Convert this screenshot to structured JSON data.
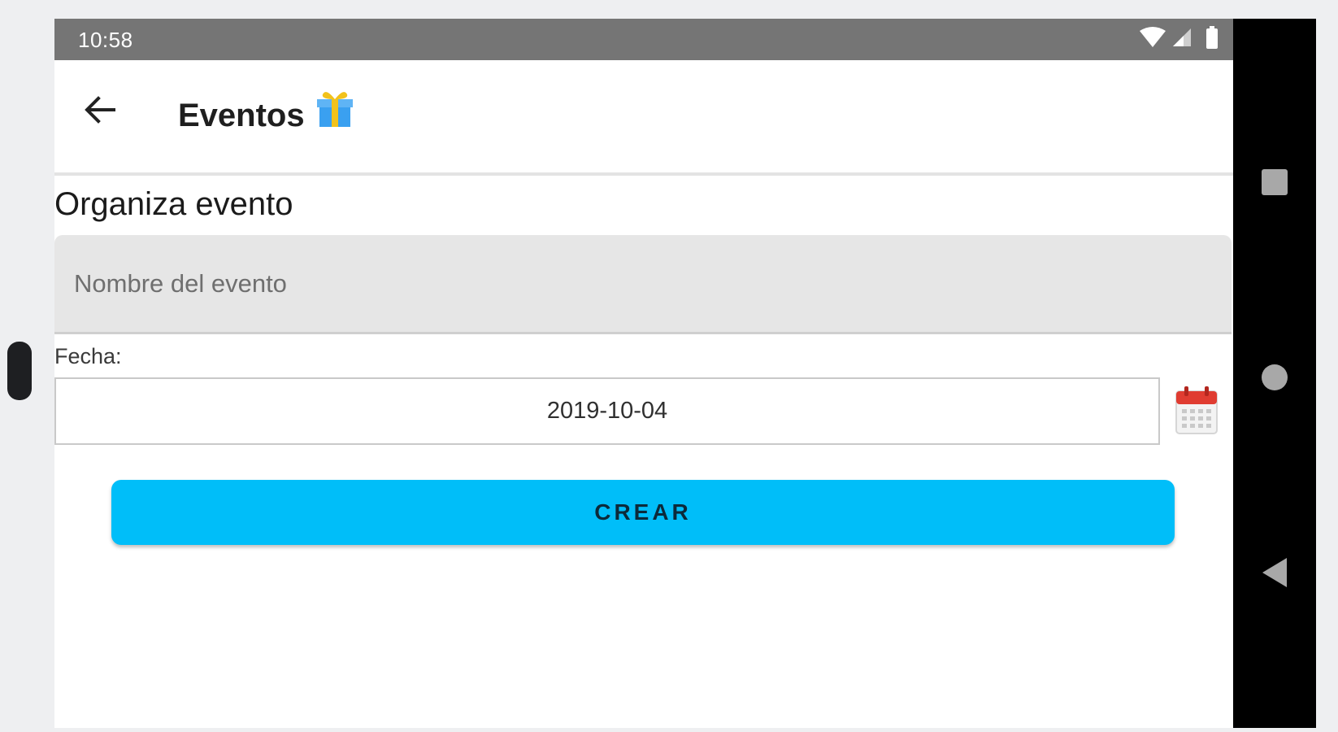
{
  "status_bar": {
    "time": "10:58",
    "icons": [
      "wifi-icon",
      "signal-icon",
      "battery-icon"
    ]
  },
  "app_bar": {
    "title": "Eventos",
    "back_icon": "arrow-left-icon",
    "title_icon": "gift-icon"
  },
  "form": {
    "section_title": "Organiza evento",
    "name_placeholder": "Nombre del evento",
    "name_value": "",
    "date_label": "Fecha:",
    "date_value": "2019-10-04",
    "calendar_icon": "calendar-icon",
    "submit_label": "CREAR"
  },
  "nav_bar": {
    "buttons": [
      "recents-button",
      "home-button",
      "back-button"
    ]
  },
  "colors": {
    "status_bar": "#757575",
    "primary_button": "#00bef9",
    "input_background": "#e6e6e6",
    "calendar_red": "#e03c31",
    "gift_blue": "#3aa0f0",
    "gift_ribbon": "#f2c21b"
  }
}
